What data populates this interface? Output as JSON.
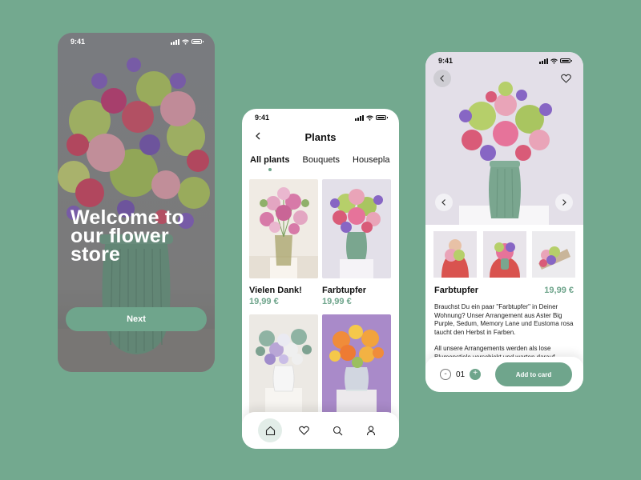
{
  "status_time": "9:41",
  "colors": {
    "background": "#73a98f",
    "accent": "#6fa58c",
    "text": "#111111"
  },
  "welcome_screen": {
    "headline": "Welcome to our flower store",
    "next_label": "Next"
  },
  "plants_screen": {
    "title": "Plants",
    "tabs": [
      {
        "label": "All plants",
        "active": true
      },
      {
        "label": "Bouquets",
        "active": false
      },
      {
        "label": "Housepla",
        "active": false
      }
    ],
    "products": [
      {
        "name": "Vielen Dank!",
        "price": "19,99 €"
      },
      {
        "name": "Farbtupfer",
        "price": "19,99 €"
      },
      {
        "name": "",
        "price": ""
      },
      {
        "name": "",
        "price": ""
      }
    ],
    "nav": [
      "home-icon",
      "heart-icon",
      "search-icon",
      "user-icon"
    ]
  },
  "detail_screen": {
    "name": "Farbtupfer",
    "price": "19,99 €",
    "description_1": "Brauchst Du ein paar \"Farbtupfer\" in Deiner Wohnung? Unser Arrangement aus Aster Big Purple, Sedum, Memory Lane und Eustoma rosa taucht den Herbst in Farben.",
    "description_2": "All unsere Arrangements werden als lose Blumenstiele verschickt und warten darauf,",
    "qty_minus": "-",
    "quantity": "01",
    "qty_plus": "+",
    "add_label": "Add to card"
  }
}
